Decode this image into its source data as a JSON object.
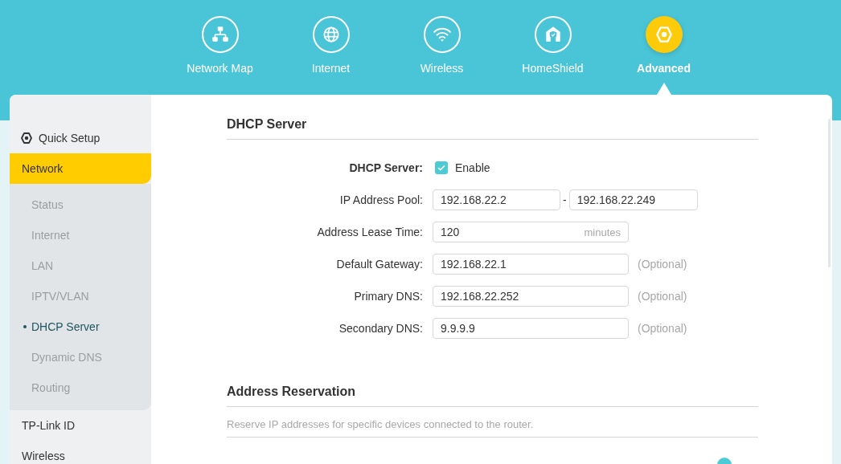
{
  "nav": [
    {
      "label": "Network Map",
      "selected": false
    },
    {
      "label": "Internet",
      "selected": false
    },
    {
      "label": "Wireless",
      "selected": false
    },
    {
      "label": "HomeShield",
      "selected": false
    },
    {
      "label": "Advanced",
      "selected": true
    }
  ],
  "sidebar": {
    "items": [
      {
        "label": "Quick Setup",
        "kind": "setup"
      },
      {
        "label": "Network",
        "kind": "group",
        "selected": true,
        "expanded": true,
        "children": [
          {
            "label": "Status",
            "selected": false
          },
          {
            "label": "Internet",
            "selected": false
          },
          {
            "label": "LAN",
            "selected": false
          },
          {
            "label": "IPTV/VLAN",
            "selected": false
          },
          {
            "label": "DHCP Server",
            "selected": true
          },
          {
            "label": "Dynamic DNS",
            "selected": false
          },
          {
            "label": "Routing",
            "selected": false
          }
        ]
      },
      {
        "label": "TP-Link ID",
        "kind": "group",
        "selected": false
      },
      {
        "label": "Wireless",
        "kind": "group",
        "selected": false
      }
    ]
  },
  "dhcp_section": {
    "title": "DHCP Server",
    "fields": [
      {
        "kind": "checkbox",
        "label": "DHCP Server:",
        "checked": true,
        "option": "Enable"
      },
      {
        "kind": "range",
        "label": "IP Address Pool:",
        "from": "192.168.22.2",
        "separator": "-",
        "to": "192.168.22.249"
      },
      {
        "kind": "input",
        "label": "Address Lease Time:",
        "value": "120",
        "unit": "minutes"
      },
      {
        "kind": "input",
        "label": "Default Gateway:",
        "value": "192.168.22.1",
        "note": "(Optional)"
      },
      {
        "kind": "input",
        "label": "Primary DNS:",
        "value": "192.168.22.252",
        "note": "(Optional)"
      },
      {
        "kind": "input",
        "label": "Secondary DNS:",
        "value": "9.9.9.9",
        "note": "(Optional)"
      }
    ]
  },
  "reservation_section": {
    "title": "Address Reservation",
    "description": "Reserve IP addresses for specific devices connected to the router."
  }
}
